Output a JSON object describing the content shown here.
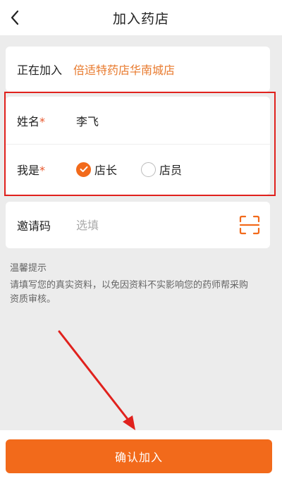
{
  "header": {
    "title": "加入药店",
    "back_icon": "chevron-left-icon"
  },
  "joining": {
    "label": "正在加入",
    "store_name": "倍适特药店华南城店"
  },
  "form": {
    "name_label": "姓名",
    "name_value": "李飞",
    "role_label": "我是",
    "required_mark": "*",
    "roles": [
      {
        "label": "店长",
        "checked": true
      },
      {
        "label": "店员",
        "checked": false
      }
    ]
  },
  "invite": {
    "label": "邀请码",
    "placeholder": "选填",
    "scan_icon": "scan-icon"
  },
  "tip": {
    "title": "温馨提示",
    "body": "请填写您的真实资料，以免因资料不实影响您的药师帮采购资质审核。"
  },
  "footer": {
    "confirm_label": "确认加入"
  },
  "colors": {
    "accent": "#f26a1b",
    "store_text": "#e8792c",
    "annotation": "#e0211d",
    "background": "#ececec"
  }
}
